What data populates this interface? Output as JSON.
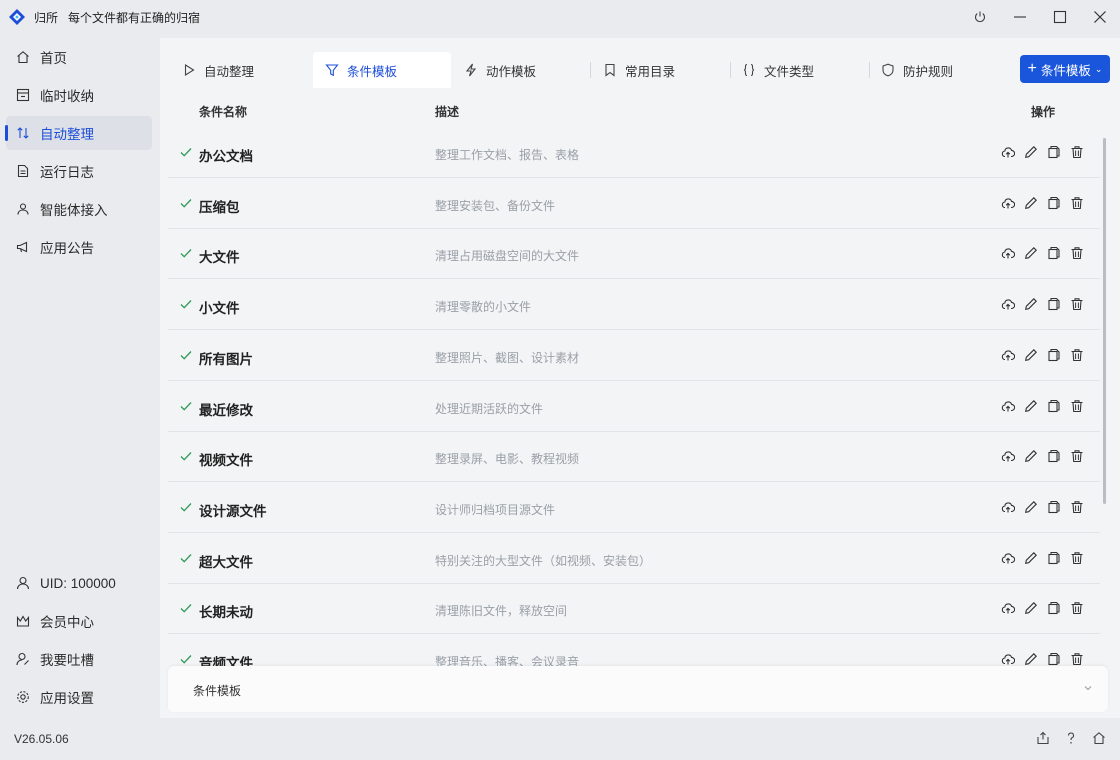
{
  "titlebar": {
    "app_name": "归所",
    "slogan": "每个文件都有正确的归宿",
    "logo_icon": "diamond-logo",
    "controls": [
      "power-icon",
      "minimize-icon",
      "maximize-icon",
      "close-icon"
    ]
  },
  "sidebar": {
    "items": [
      {
        "label": "首页",
        "icon": "home-icon"
      },
      {
        "label": "临时收纳",
        "icon": "inbox-icon"
      },
      {
        "label": "自动整理",
        "icon": "sort-arrows-icon",
        "active": true
      },
      {
        "label": "运行日志",
        "icon": "log-icon"
      },
      {
        "label": "智能体接入",
        "icon": "agent-icon"
      },
      {
        "label": "应用公告",
        "icon": "megaphone-icon"
      }
    ],
    "bottom_items": [
      {
        "label": "UID: 100000",
        "icon": "user-icon"
      },
      {
        "label": "会员中心",
        "icon": "crown-icon"
      },
      {
        "label": "我要吐槽",
        "icon": "feedback-icon"
      },
      {
        "label": "应用设置",
        "icon": "settings-icon"
      }
    ],
    "version": "V26.05.06"
  },
  "tabs": [
    {
      "label": "自动整理",
      "icon": "play-icon"
    },
    {
      "label": "条件模板",
      "icon": "filter-icon",
      "active": true
    },
    {
      "label": "动作模板",
      "icon": "bolt-icon"
    },
    {
      "label": "常用目录",
      "icon": "bookmark-icon"
    },
    {
      "label": "文件类型",
      "icon": "braces-icon"
    },
    {
      "label": "防护规则",
      "icon": "shield-icon"
    }
  ],
  "add_button": {
    "label": "条件模板",
    "icon": "plus-icon"
  },
  "table": {
    "headers": {
      "name": "条件名称",
      "desc": "描述",
      "ops": "操作"
    },
    "rows": [
      {
        "name": "办公文档",
        "desc": "整理工作文档、报告、表格"
      },
      {
        "name": "压缩包",
        "desc": "整理安装包、备份文件"
      },
      {
        "name": "大文件",
        "desc": "清理占用磁盘空间的大文件"
      },
      {
        "name": "小文件",
        "desc": "清理零散的小文件"
      },
      {
        "name": "所有图片",
        "desc": "整理照片、截图、设计素材"
      },
      {
        "name": "最近修改",
        "desc": "处理近期活跃的文件"
      },
      {
        "name": "视频文件",
        "desc": "整理录屏、电影、教程视频"
      },
      {
        "name": "设计源文件",
        "desc": "设计师归档项目源文件"
      },
      {
        "name": "超大文件",
        "desc": "特别关注的大型文件（如视频、安装包）"
      },
      {
        "name": "长期未动",
        "desc": "清理陈旧文件，释放空间"
      },
      {
        "name": "音频文件",
        "desc": "整理音乐、播客、会议录音"
      }
    ],
    "row_actions": [
      "upload-icon",
      "edit-icon",
      "copy-icon",
      "delete-icon"
    ]
  },
  "bottom_panel": {
    "label": "条件模板",
    "icon": "chevron-down-icon"
  },
  "footer_icons": [
    "share-icon",
    "help-icon",
    "home-icon"
  ],
  "colors": {
    "accent": "#1d4ed8",
    "primary_button": "#1a56db",
    "check": "#2e9b57"
  }
}
